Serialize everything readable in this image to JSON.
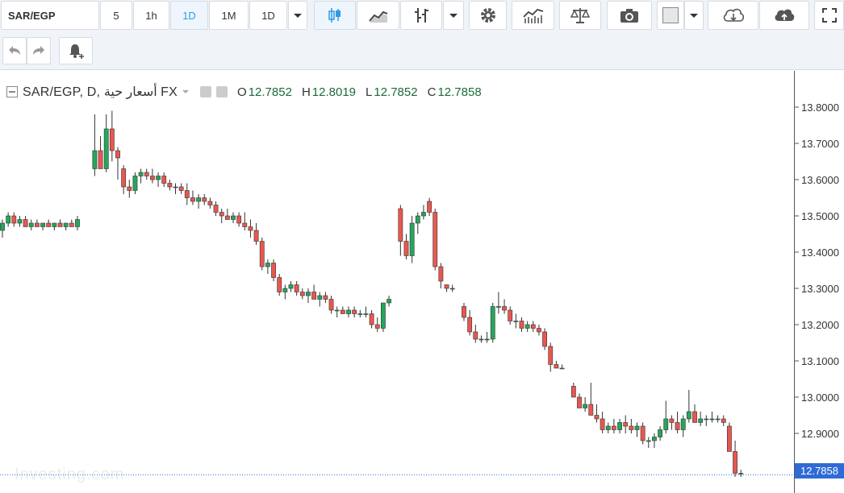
{
  "toolbar": {
    "symbol": "SAR/EGP",
    "intervals": [
      "5",
      "1h",
      "1D",
      "1M",
      "1D"
    ],
    "active_interval": "1D",
    "icons": [
      "candles-icon",
      "area-chart-icon",
      "bars-icon",
      "chevron-down-icon",
      "gear-icon",
      "indicators-icon",
      "scales-icon",
      "camera-icon",
      "color-square-icon",
      "chevron-down-icon",
      "cloud-download-icon",
      "cloud-upload-icon",
      "fullscreen-icon"
    ]
  },
  "toolbar2": {
    "icons": [
      "undo-icon",
      "redo-icon",
      "alert-bell-icon"
    ]
  },
  "legend": {
    "symbol_line": "SAR/EGP, D, أسعار حية FX",
    "open_label": "O",
    "open": "12.7852",
    "high_label": "H",
    "high": "12.8019",
    "low_label": "L",
    "low": "12.7852",
    "close_label": "C",
    "close": "12.7858"
  },
  "last_price_label": "12.7858",
  "colors": {
    "up": "#26a65b",
    "down": "#e8574f",
    "wick": "#333333",
    "last_line": "#2e6bd6",
    "ohlc_values": "#1d6b3a"
  },
  "chart_data": {
    "type": "candlestick",
    "title": "",
    "ylim": [
      12.76,
      13.85
    ],
    "y_ticks": [
      13.8,
      13.7,
      13.6,
      13.5,
      13.4,
      13.3,
      13.2,
      13.1,
      13.0,
      12.9,
      12.8
    ],
    "y_tick_labels": [
      "13.8000",
      "13.7000",
      "13.6000",
      "13.5000",
      "13.4000",
      "13.3000",
      "13.2000",
      "13.1000",
      "13.0000",
      "12.9000",
      "12.8000"
    ],
    "last_value": 12.7858,
    "grid": false,
    "candles": [
      [
        13.46,
        13.49,
        13.44,
        13.48
      ],
      [
        13.48,
        13.51,
        13.47,
        13.5
      ],
      [
        13.5,
        13.51,
        13.47,
        13.48
      ],
      [
        13.48,
        13.5,
        13.47,
        13.49
      ],
      [
        13.49,
        13.5,
        13.47,
        13.47
      ],
      [
        13.47,
        13.49,
        13.46,
        13.48
      ],
      [
        13.48,
        13.49,
        13.47,
        13.47
      ],
      [
        13.47,
        13.48,
        13.46,
        13.48
      ],
      [
        13.48,
        13.49,
        13.47,
        13.47
      ],
      [
        13.47,
        13.48,
        13.46,
        13.48
      ],
      [
        13.48,
        13.49,
        13.47,
        13.47
      ],
      [
        13.47,
        13.48,
        13.46,
        13.48
      ],
      [
        13.48,
        13.49,
        13.47,
        13.47
      ],
      [
        13.47,
        13.5,
        13.46,
        13.49
      ],
      [
        13.63,
        13.78,
        13.61,
        13.68
      ],
      [
        13.68,
        13.72,
        13.65,
        13.63
      ],
      [
        13.63,
        13.78,
        13.62,
        13.74
      ],
      [
        13.74,
        13.79,
        13.65,
        13.68
      ],
      [
        13.68,
        13.69,
        13.6,
        13.66
      ],
      [
        13.63,
        13.64,
        13.56,
        13.58
      ],
      [
        13.58,
        13.6,
        13.55,
        13.57
      ],
      [
        13.57,
        13.62,
        13.56,
        13.61
      ],
      [
        13.61,
        13.63,
        13.59,
        13.62
      ],
      [
        13.62,
        13.63,
        13.6,
        13.61
      ],
      [
        13.61,
        13.63,
        13.59,
        13.6
      ],
      [
        13.6,
        13.62,
        13.58,
        13.61
      ],
      [
        13.61,
        13.62,
        13.58,
        13.59
      ],
      [
        13.59,
        13.6,
        13.57,
        13.58
      ],
      [
        13.58,
        13.59,
        13.56,
        13.58
      ],
      [
        13.58,
        13.59,
        13.56,
        13.57
      ],
      [
        13.57,
        13.59,
        13.53,
        13.55
      ],
      [
        13.55,
        13.57,
        13.53,
        13.54
      ],
      [
        13.54,
        13.56,
        13.52,
        13.55
      ],
      [
        13.55,
        13.56,
        13.53,
        13.54
      ],
      [
        13.54,
        13.55,
        13.52,
        13.53
      ],
      [
        13.53,
        13.54,
        13.5,
        13.51
      ],
      [
        13.51,
        13.52,
        13.48,
        13.5
      ],
      [
        13.5,
        13.52,
        13.49,
        13.49
      ],
      [
        13.49,
        13.51,
        13.48,
        13.5
      ],
      [
        13.5,
        13.51,
        13.47,
        13.48
      ],
      [
        13.48,
        13.51,
        13.46,
        13.47
      ],
      [
        13.47,
        13.49,
        13.44,
        13.46
      ],
      [
        13.46,
        13.48,
        13.42,
        13.43
      ],
      [
        13.43,
        13.44,
        13.35,
        13.36
      ],
      [
        13.36,
        13.38,
        13.34,
        13.37
      ],
      [
        13.37,
        13.38,
        13.32,
        13.33
      ],
      [
        13.33,
        13.34,
        13.28,
        13.29
      ],
      [
        13.29,
        13.31,
        13.27,
        13.3
      ],
      [
        13.3,
        13.32,
        13.29,
        13.31
      ],
      [
        13.31,
        13.32,
        13.28,
        13.29
      ],
      [
        13.29,
        13.3,
        13.27,
        13.28
      ],
      [
        13.28,
        13.3,
        13.26,
        13.29
      ],
      [
        13.29,
        13.31,
        13.27,
        13.27
      ],
      [
        13.27,
        13.29,
        13.25,
        13.28
      ],
      [
        13.28,
        13.29,
        13.26,
        13.27
      ],
      [
        13.27,
        13.28,
        13.23,
        13.24
      ],
      [
        13.24,
        13.25,
        13.22,
        13.24
      ],
      [
        13.24,
        13.25,
        13.23,
        13.23
      ],
      [
        13.23,
        13.25,
        13.22,
        13.24
      ],
      [
        13.24,
        13.25,
        13.22,
        13.23
      ],
      [
        13.23,
        13.24,
        13.22,
        13.23
      ],
      [
        13.23,
        13.25,
        13.22,
        13.23
      ],
      [
        13.23,
        13.24,
        13.19,
        13.2
      ],
      [
        13.2,
        13.22,
        13.18,
        13.19
      ],
      [
        13.19,
        13.26,
        13.18,
        13.26
      ],
      [
        13.26,
        13.28,
        13.25,
        13.27
      ],
      [
        13.52,
        13.53,
        13.39,
        13.43
      ],
      [
        13.43,
        13.45,
        13.38,
        13.39
      ],
      [
        13.39,
        13.5,
        13.37,
        13.48
      ],
      [
        13.48,
        13.51,
        13.45,
        13.5
      ],
      [
        13.5,
        13.53,
        13.49,
        13.51
      ],
      [
        13.54,
        13.55,
        13.5,
        13.51
      ],
      [
        13.51,
        13.52,
        13.35,
        13.36
      ],
      [
        13.36,
        13.37,
        13.3,
        13.32
      ],
      [
        13.31,
        13.31,
        13.29,
        13.3
      ],
      [
        13.3,
        13.31,
        13.29,
        13.3
      ],
      [
        13.25,
        13.26,
        13.21,
        13.22
      ],
      [
        13.22,
        13.24,
        13.17,
        13.18
      ],
      [
        13.18,
        13.2,
        13.15,
        13.16
      ],
      [
        13.16,
        13.17,
        13.15,
        13.16
      ],
      [
        13.16,
        13.18,
        13.15,
        13.16
      ],
      [
        13.16,
        13.26,
        13.15,
        13.25
      ],
      [
        13.25,
        13.29,
        13.23,
        13.25
      ],
      [
        13.25,
        13.27,
        13.23,
        13.24
      ],
      [
        13.24,
        13.25,
        13.2,
        13.21
      ],
      [
        13.21,
        13.23,
        13.19,
        13.21
      ],
      [
        13.21,
        13.22,
        13.18,
        13.19
      ],
      [
        13.19,
        13.21,
        13.18,
        13.2
      ],
      [
        13.2,
        13.21,
        13.18,
        13.19
      ],
      [
        13.19,
        13.2,
        13.17,
        13.18
      ],
      [
        13.18,
        13.19,
        13.13,
        13.14
      ],
      [
        13.14,
        13.15,
        13.07,
        13.09
      ],
      [
        13.09,
        13.1,
        13.08,
        13.08
      ],
      [
        13.08,
        13.09,
        13.08,
        13.08
      ],
      [
        13.03,
        13.04,
        13.0,
        13.0
      ],
      [
        13.0,
        13.01,
        12.97,
        12.97
      ],
      [
        12.97,
        13.0,
        12.96,
        12.98
      ],
      [
        12.98,
        13.04,
        12.95,
        12.95
      ],
      [
        12.95,
        12.98,
        12.93,
        12.94
      ],
      [
        12.94,
        12.96,
        12.9,
        12.91
      ],
      [
        12.91,
        12.93,
        12.9,
        12.92
      ],
      [
        12.92,
        12.94,
        12.9,
        12.91
      ],
      [
        12.91,
        12.94,
        12.9,
        12.93
      ],
      [
        12.93,
        12.95,
        12.9,
        12.92
      ],
      [
        12.92,
        12.94,
        12.9,
        12.91
      ],
      [
        12.91,
        12.93,
        12.89,
        12.92
      ],
      [
        12.92,
        12.93,
        12.87,
        12.88
      ],
      [
        12.88,
        12.89,
        12.86,
        12.88
      ],
      [
        12.88,
        12.9,
        12.86,
        12.89
      ],
      [
        12.89,
        12.92,
        12.88,
        12.91
      ],
      [
        12.91,
        12.99,
        12.9,
        12.94
      ],
      [
        12.94,
        12.95,
        12.91,
        12.93
      ],
      [
        12.93,
        12.96,
        12.9,
        12.91
      ],
      [
        12.91,
        12.95,
        12.89,
        12.94
      ],
      [
        12.94,
        13.02,
        12.93,
        12.96
      ],
      [
        12.96,
        12.98,
        12.93,
        12.93
      ],
      [
        12.93,
        12.96,
        12.92,
        12.94
      ],
      [
        12.94,
        12.95,
        12.92,
        12.94
      ],
      [
        12.94,
        12.96,
        12.93,
        12.94
      ],
      [
        12.94,
        12.95,
        12.93,
        12.94
      ],
      [
        12.94,
        12.95,
        12.92,
        12.93
      ],
      [
        12.92,
        12.93,
        12.85,
        12.85
      ],
      [
        12.85,
        12.88,
        12.78,
        12.79
      ],
      [
        12.79,
        12.8,
        12.78,
        12.79
      ]
    ]
  }
}
